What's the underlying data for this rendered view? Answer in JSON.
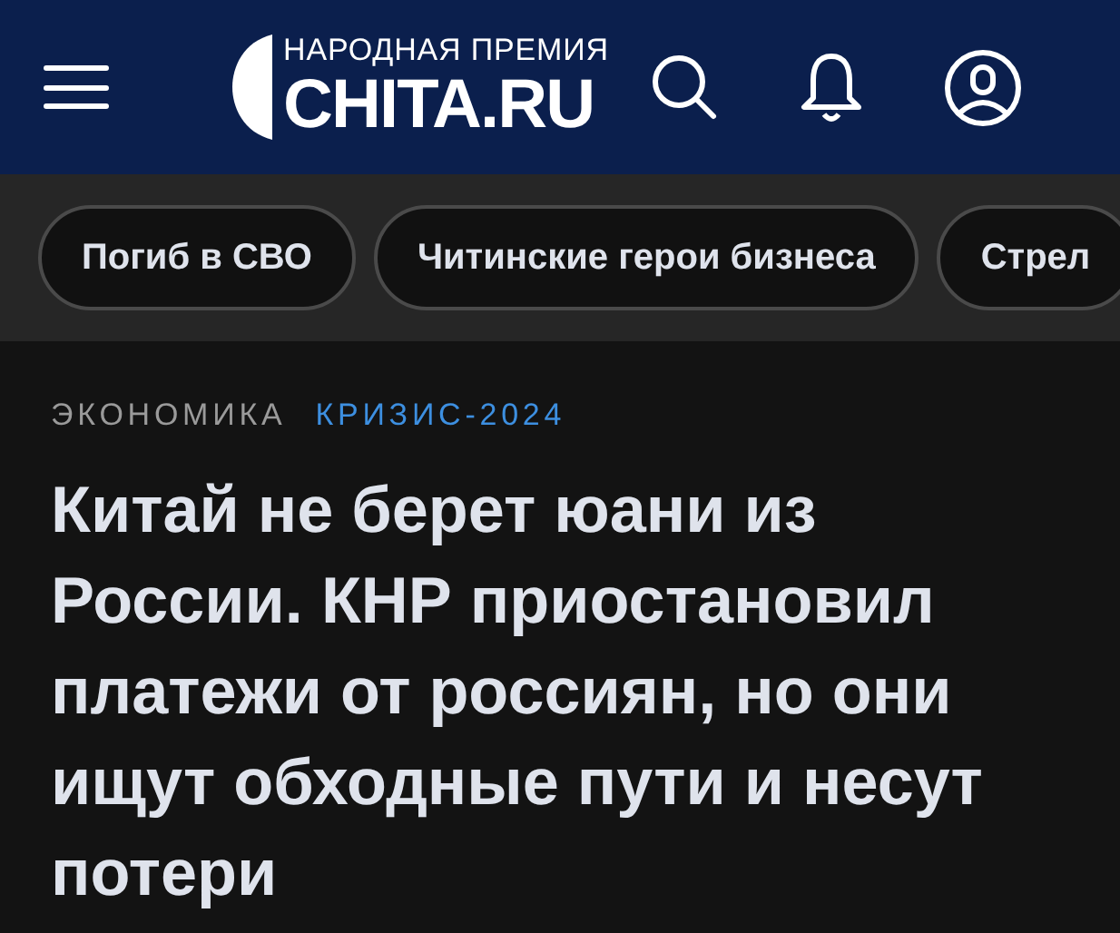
{
  "header": {
    "logo_caption": "НАРОДНАЯ ПРЕМИЯ",
    "logo_text": "CHITA.RU"
  },
  "tags": [
    {
      "label": "Погиб в СВО"
    },
    {
      "label": "Читинские герои бизнеса"
    },
    {
      "label": "Стрел"
    }
  ],
  "article": {
    "categories": [
      {
        "label": "ЭКОНОМИКА",
        "kind": "section"
      },
      {
        "label": "КРИЗИС-2024",
        "kind": "topic"
      }
    ],
    "title": "Китай не берет юани из России. КНР приостановил платежи от россиян, но они ищут обходные пути и несут потери"
  }
}
